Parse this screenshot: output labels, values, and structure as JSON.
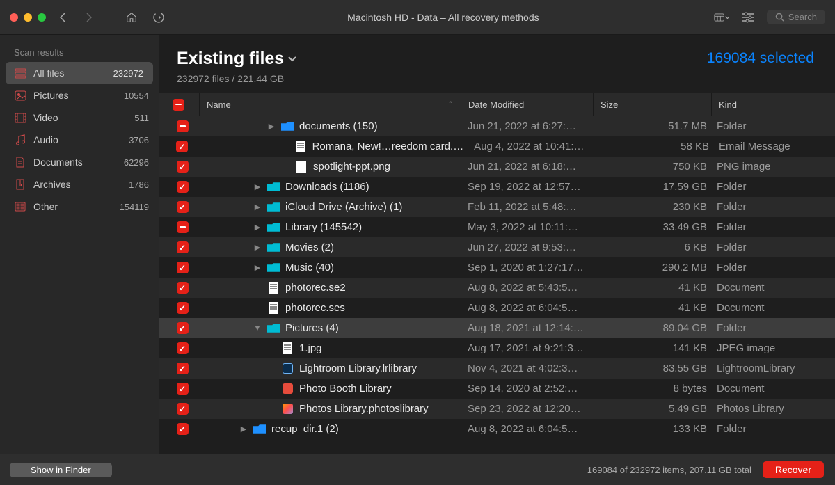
{
  "window": {
    "title": "Macintosh HD - Data – All recovery methods",
    "search_placeholder": "Search"
  },
  "sidebar": {
    "heading": "Scan results",
    "items": [
      {
        "label": "All files",
        "count": "232972",
        "active": true,
        "icon": "stack"
      },
      {
        "label": "Pictures",
        "count": "10554",
        "icon": "image"
      },
      {
        "label": "Video",
        "count": "511",
        "icon": "film"
      },
      {
        "label": "Audio",
        "count": "3706",
        "icon": "music"
      },
      {
        "label": "Documents",
        "count": "62296",
        "icon": "doc"
      },
      {
        "label": "Archives",
        "count": "1786",
        "icon": "archive"
      },
      {
        "label": "Other",
        "count": "154119",
        "icon": "other"
      }
    ]
  },
  "header": {
    "title": "Existing files",
    "subtitle": "232972 files / 221.44 GB",
    "selected": "169084 selected"
  },
  "columns": {
    "name": "Name",
    "date": "Date Modified",
    "size": "Size",
    "kind": "Kind"
  },
  "rows": [
    {
      "chk": "minus",
      "indent": 4,
      "disc": "right",
      "ico": "folder",
      "name": "documents (150)",
      "date": "Jun 21, 2022 at 6:27:…",
      "size": "51.7 MB",
      "kind": "Folder"
    },
    {
      "chk": "check",
      "indent": 5,
      "disc": "",
      "ico": "doc",
      "name": "Romana, New!…reedom card.eml",
      "date": "Aug 4, 2022 at 10:41:…",
      "size": "58 KB",
      "kind": "Email Message"
    },
    {
      "chk": "check",
      "indent": 5,
      "disc": "",
      "ico": "png",
      "name": "spotlight-ppt.png",
      "date": "Jun 21, 2022 at 6:18:…",
      "size": "750 KB",
      "kind": "PNG image"
    },
    {
      "chk": "check",
      "indent": 3,
      "disc": "right",
      "ico": "folder-cyan",
      "name": "Downloads (1186)",
      "date": "Sep 19, 2022 at 12:57…",
      "size": "17.59 GB",
      "kind": "Folder"
    },
    {
      "chk": "check",
      "indent": 3,
      "disc": "right",
      "ico": "folder-cyan",
      "name": "iCloud Drive (Archive) (1)",
      "date": "Feb 11, 2022 at 5:48:…",
      "size": "230 KB",
      "kind": "Folder"
    },
    {
      "chk": "minus",
      "indent": 3,
      "disc": "right",
      "ico": "folder-cyan",
      "name": "Library (145542)",
      "date": "May 3, 2022 at 10:11:…",
      "size": "33.49 GB",
      "kind": "Folder"
    },
    {
      "chk": "check",
      "indent": 3,
      "disc": "right",
      "ico": "folder-cyan",
      "name": "Movies (2)",
      "date": "Jun 27, 2022 at 9:53:…",
      "size": "6 KB",
      "kind": "Folder"
    },
    {
      "chk": "check",
      "indent": 3,
      "disc": "right",
      "ico": "folder-cyan",
      "name": "Music (40)",
      "date": "Sep 1, 2020 at 1:27:17…",
      "size": "290.2 MB",
      "kind": "Folder"
    },
    {
      "chk": "check",
      "indent": 3,
      "disc": "",
      "ico": "doc",
      "name": "photorec.se2",
      "date": "Aug 8, 2022 at 5:43:5…",
      "size": "41 KB",
      "kind": "Document"
    },
    {
      "chk": "check",
      "indent": 3,
      "disc": "",
      "ico": "doc",
      "name": "photorec.ses",
      "date": "Aug 8, 2022 at 6:04:5…",
      "size": "41 KB",
      "kind": "Document"
    },
    {
      "chk": "check",
      "indent": 3,
      "disc": "down",
      "ico": "folder-cyan",
      "name": "Pictures (4)",
      "date": "Aug 18, 2021 at 12:14:…",
      "size": "89.04 GB",
      "kind": "Folder",
      "hl": true
    },
    {
      "chk": "check",
      "indent": 4,
      "disc": "",
      "ico": "doc",
      "name": "1.jpg",
      "date": "Aug 17, 2021 at 9:21:3…",
      "size": "141 KB",
      "kind": "JPEG image"
    },
    {
      "chk": "check",
      "indent": 4,
      "disc": "",
      "ico": "lr",
      "name": "Lightroom Library.lrlibrary",
      "date": "Nov 4, 2021 at 4:02:3…",
      "size": "83.55 GB",
      "kind": "LightroomLibrary"
    },
    {
      "chk": "check",
      "indent": 4,
      "disc": "",
      "ico": "red",
      "name": "Photo Booth Library",
      "date": "Sep 14, 2020 at 2:52:…",
      "size": "8 bytes",
      "kind": "Document"
    },
    {
      "chk": "check",
      "indent": 4,
      "disc": "",
      "ico": "rainbow",
      "name": "Photos Library.photoslibrary",
      "date": "Sep 23, 2022 at 12:20…",
      "size": "5.49 GB",
      "kind": "Photos Library"
    },
    {
      "chk": "check",
      "indent": 2,
      "disc": "right",
      "ico": "folder",
      "name": "recup_dir.1 (2)",
      "date": "Aug 8, 2022 at 6:04:5…",
      "size": "133 KB",
      "kind": "Folder"
    }
  ],
  "footer": {
    "show_label": "Show in Finder",
    "status": "169084 of 232972 items, 207.11 GB total",
    "recover": "Recover"
  }
}
